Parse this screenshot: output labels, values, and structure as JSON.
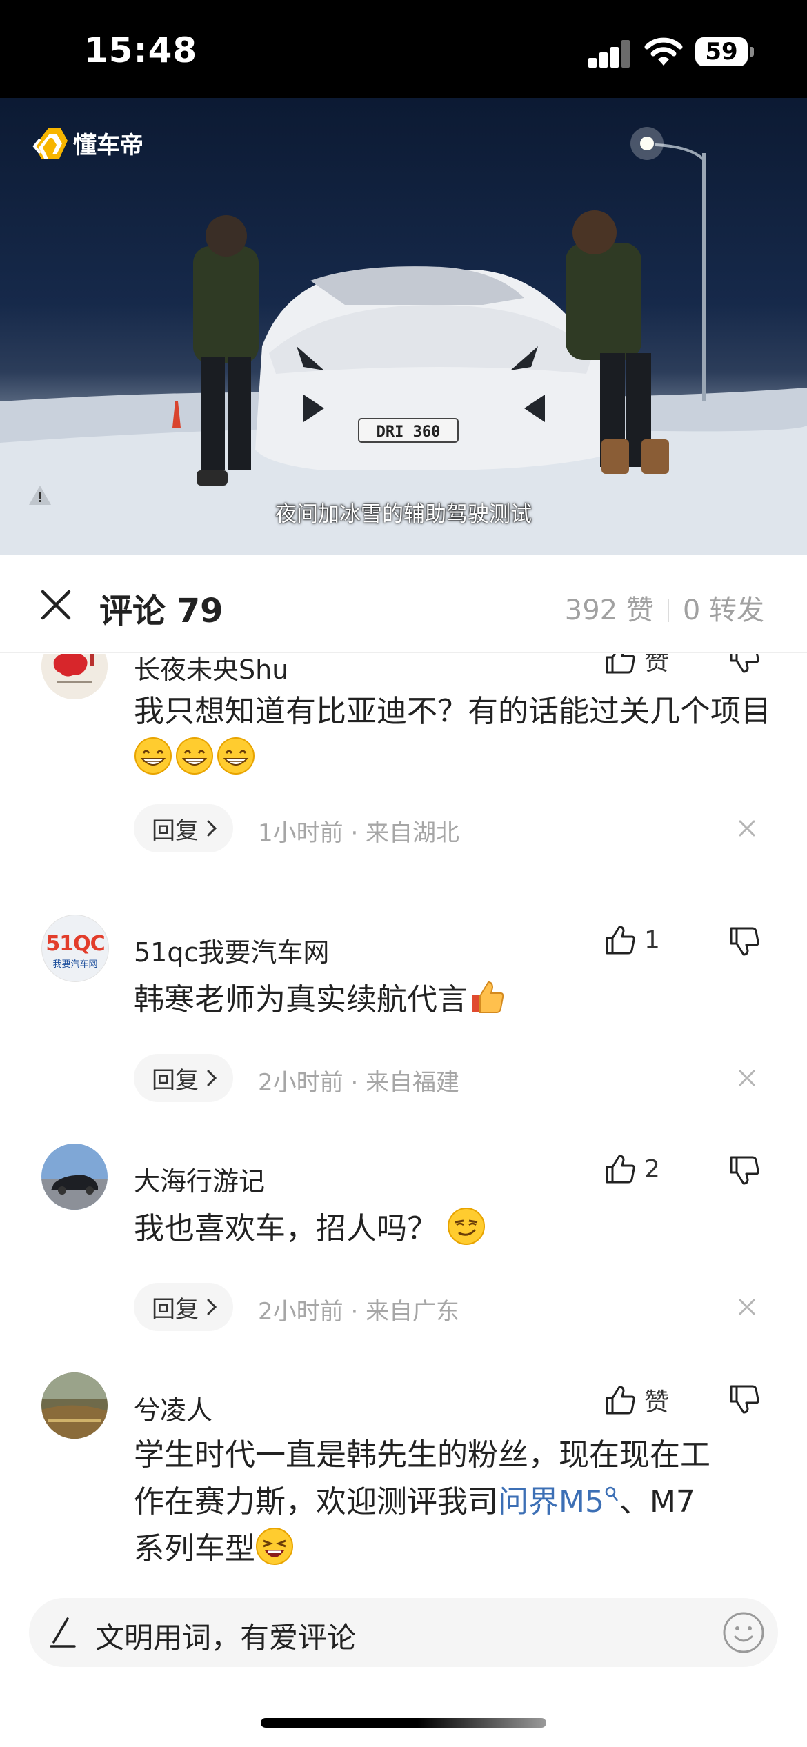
{
  "status_bar": {
    "time": "15:48",
    "battery": "59"
  },
  "video": {
    "brand": "懂车帝",
    "plate_text": "DRI 360",
    "subtitle": "夜间加冰雪的辅助驾驶测试",
    "progress_fraction": 0.505,
    "buffer_fraction": 0.78
  },
  "header": {
    "title": "评论 79",
    "likes": "392 赞",
    "shares": "0 转发"
  },
  "comments": [
    {
      "username": "长夜未央Shu",
      "like_label": "赞",
      "text_parts": [
        "我只想知道有比亚迪不？有的话能过关几个项目"
      ],
      "emojis": [
        "grin-emoji",
        "grin-emoji",
        "grin-emoji"
      ],
      "reply": "回复",
      "meta": "1小时前 · 来自湖北"
    },
    {
      "username": "51qc我要汽车网",
      "avatar_text": "51QC",
      "avatar_sub": "我要汽车网",
      "like_label": "1",
      "text_parts": [
        "韩寒老师为真实续航代言"
      ],
      "emojis": [
        "thumbs-up-emoji"
      ],
      "reply": "回复",
      "meta": "2小时前 · 来自福建"
    },
    {
      "username": "大海行游记",
      "like_label": "2",
      "text_parts": [
        "我也喜欢车，招人吗？"
      ],
      "emojis": [
        "smirk-emoji"
      ],
      "reply": "回复",
      "meta": "2小时前 · 来自广东"
    },
    {
      "username": "兮凌人",
      "like_label": "赞",
      "text_line1": "学生时代一直是韩先生的粉丝，现在现在工",
      "text_line2a": "作在赛力斯，欢迎测评我司",
      "text_link": "问界M5",
      "text_line2b": "、M7",
      "text_line3": "系列车型",
      "emojis": [
        "laugh-emoji"
      ]
    }
  ],
  "input": {
    "placeholder": "文明用词，有爱评论"
  },
  "colors": {
    "accent_red": "#e8344a",
    "link_blue": "#3c6fb5",
    "meta_gray": "#a6a6a6"
  }
}
